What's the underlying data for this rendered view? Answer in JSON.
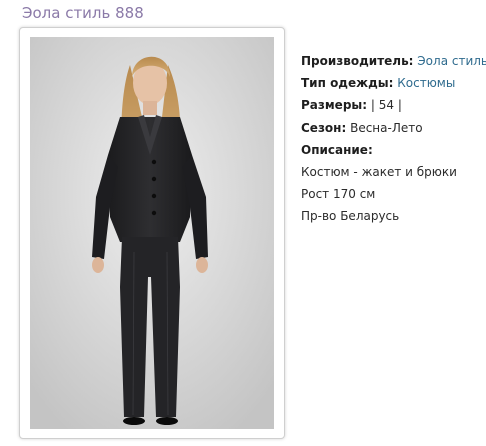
{
  "product": {
    "title": "Эола стиль 888",
    "image_alt": "woman in dark pantsuit",
    "details": {
      "manufacturer_label": "Производитель:",
      "manufacturer_value": "Эола стиль",
      "type_label": "Тип одежды:",
      "type_value": "Костюмы",
      "sizes_label": "Размеры:",
      "sizes_value": " | 54 |",
      "season_label": "Сезон:",
      "season_value": " Весна-Лето",
      "description_label": "Описание:",
      "description_lines": [
        "Костюм - жакет и брюки",
        "Рост 170 см",
        "Пр-во Беларусь"
      ]
    }
  },
  "colors": {
    "title": "#8b7aa8",
    "link": "#2f6b8e"
  }
}
